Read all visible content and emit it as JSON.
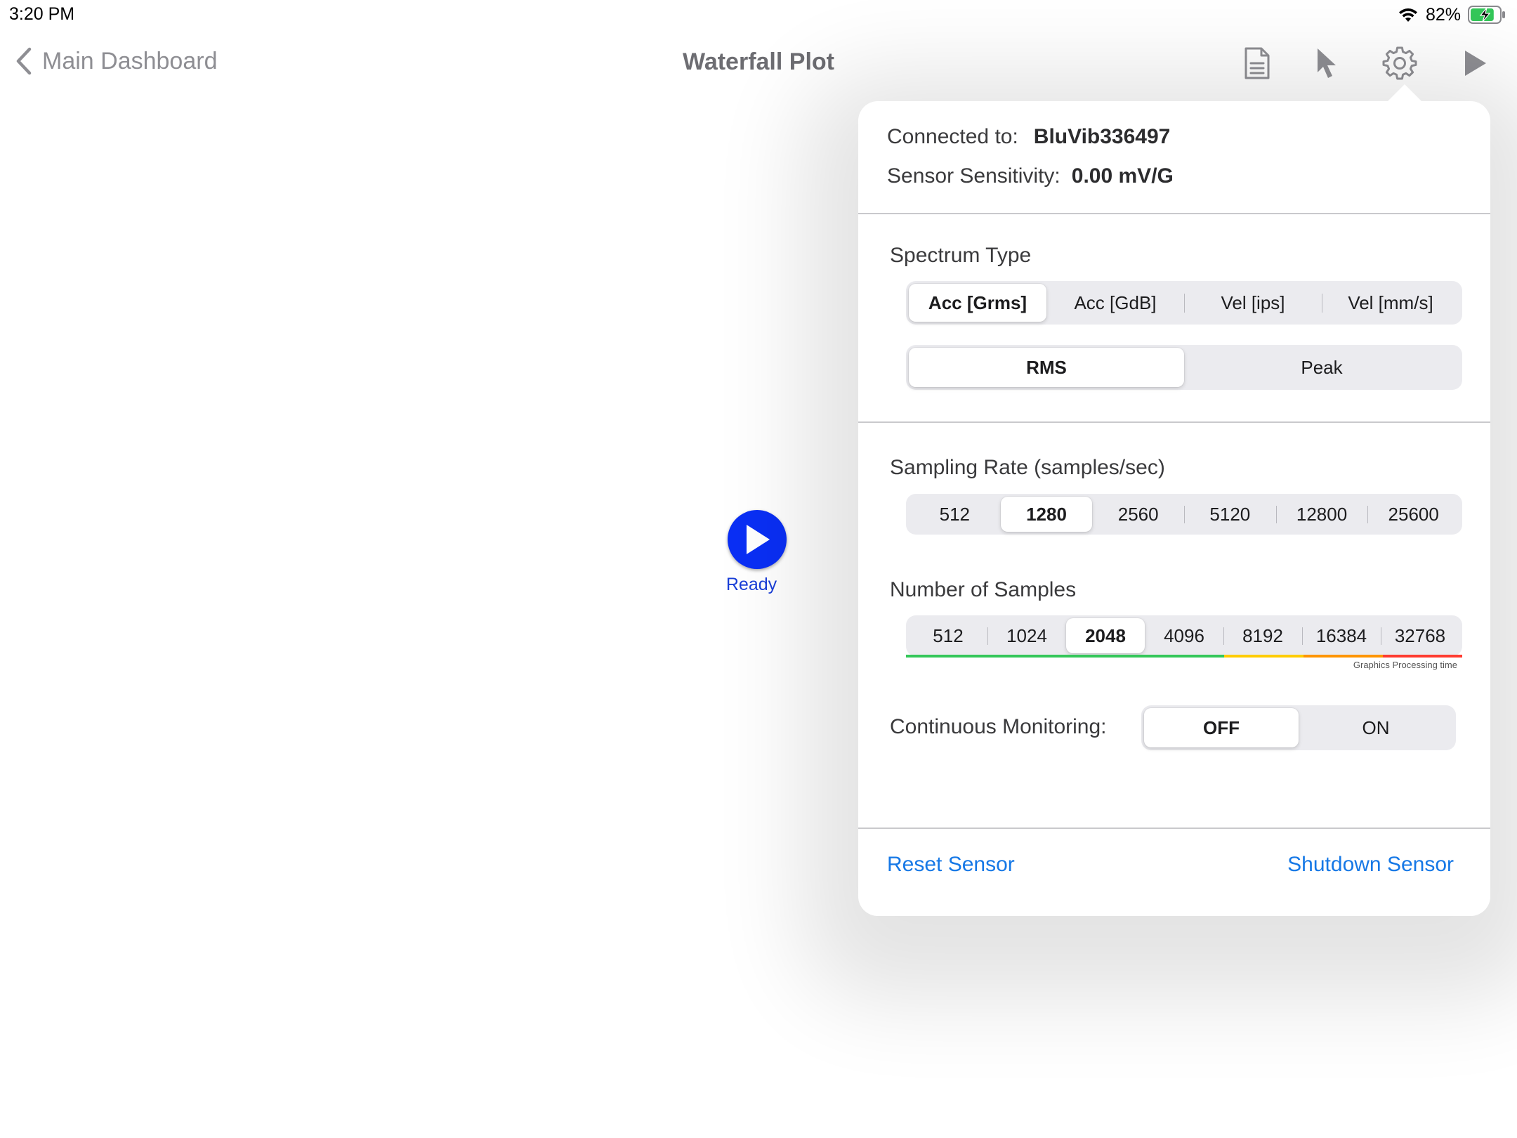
{
  "status_bar": {
    "time": "3:20 PM",
    "battery_percent": "82%",
    "battery_level": 0.82,
    "icons": [
      "wifi-icon",
      "battery-charging-icon"
    ]
  },
  "nav": {
    "back_label": "Main Dashboard",
    "title": "Waterfall Plot",
    "actions": [
      "document-icon",
      "pointer-icon",
      "gear-icon",
      "play-icon"
    ]
  },
  "start": {
    "icon": "play-icon",
    "label": "Ready",
    "color": "#0a2ff5"
  },
  "settings": {
    "connected_label": "Connected to:",
    "connected_value": "BluVib336497",
    "sensitivity_label": "Sensor Sensitivity:",
    "sensitivity_value": "0.00 mV/G",
    "spectrum_type": {
      "label": "Spectrum Type",
      "options": [
        "Acc [Grms]",
        "Acc [GdB]",
        "Vel [ips]",
        "Vel [mm/s]"
      ],
      "selected": "Acc [Grms]"
    },
    "amplitude_mode": {
      "options": [
        "RMS",
        "Peak"
      ],
      "selected": "RMS"
    },
    "sampling_rate": {
      "label": "Sampling Rate (samples/sec)",
      "options": [
        "512",
        "1280",
        "2560",
        "5120",
        "12800",
        "25600"
      ],
      "selected": "1280"
    },
    "number_of_samples": {
      "label": "Number of Samples",
      "options": [
        "512",
        "1024",
        "2048",
        "4096",
        "8192",
        "16384",
        "32768"
      ],
      "selected": "2048",
      "processing_caption": "Graphics Processing time",
      "processing_colors": [
        "#34c759",
        "#34c759",
        "#34c759",
        "#34c759",
        "#ffcc00",
        "#ff9500",
        "#ff3b30"
      ]
    },
    "continuous_monitoring": {
      "label": "Continuous Monitoring:",
      "options": [
        "OFF",
        "ON"
      ],
      "selected": "OFF"
    },
    "reset_label": "Reset Sensor",
    "shutdown_label": "Shutdown Sensor",
    "link_color": "#1678e6"
  }
}
